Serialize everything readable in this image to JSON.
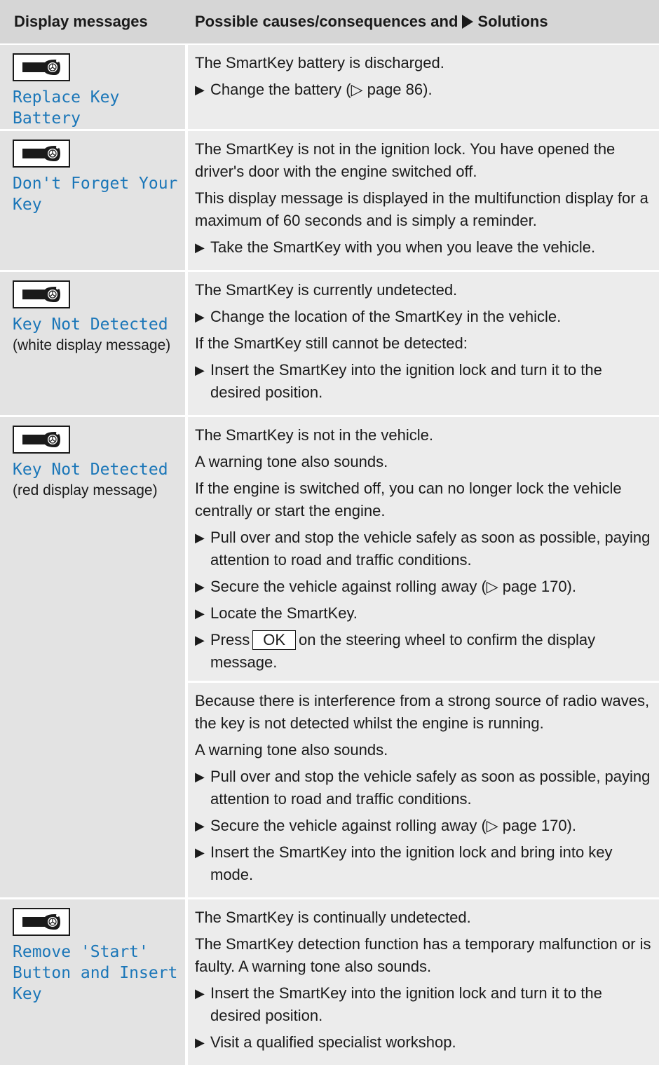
{
  "header": {
    "col1": "Display messages",
    "col2_prefix": "Possible causes/consequences and",
    "col2_suffix": "Solutions"
  },
  "rows": [
    {
      "message": "Replace Key Battery",
      "icon": "smartkey-icon",
      "blocks": [
        {
          "type": "p",
          "text": "The SmartKey battery is discharged."
        },
        {
          "type": "step",
          "text": "Change the battery (▷ page 86)."
        }
      ]
    },
    {
      "message": "Don't Forget Your Key",
      "icon": "smartkey-icon",
      "blocks": [
        {
          "type": "p",
          "text": "The SmartKey is not in the ignition lock. You have opened the driver's door with the engine switched off."
        },
        {
          "type": "p",
          "text": "This display message is displayed in the multifunction display for a maximum of 60 seconds and is simply a reminder."
        },
        {
          "type": "step",
          "text": "Take the SmartKey with you when you leave the vehicle."
        }
      ]
    },
    {
      "message": "Key Not Detected",
      "note": "(white display message)",
      "icon": "smartkey-icon",
      "blocks": [
        {
          "type": "p",
          "text": "The SmartKey is currently undetected."
        },
        {
          "type": "step",
          "text": "Change the location of the SmartKey in the vehicle."
        },
        {
          "type": "p",
          "text": "If the SmartKey still cannot be detected:"
        },
        {
          "type": "step",
          "text": "Insert the SmartKey into the ignition lock and turn it to the desired position."
        }
      ]
    },
    {
      "message": "Key Not Detected",
      "note": "(red display message)",
      "icon": "smartkey-icon",
      "blocks": [
        {
          "type": "p",
          "text": "The SmartKey is not in the vehicle."
        },
        {
          "type": "p",
          "text": "A warning tone also sounds."
        },
        {
          "type": "p",
          "text": "If the engine is switched off, you can no longer lock the vehicle centrally or start the engine."
        },
        {
          "type": "step",
          "text": "Pull over and stop the vehicle safely as soon as possible, paying attention to road and traffic conditions."
        },
        {
          "type": "step",
          "text": "Secure the vehicle against rolling away (▷ page 170)."
        },
        {
          "type": "step",
          "text": "Locate the SmartKey."
        },
        {
          "type": "stepok",
          "before": "Press",
          "key": "OK",
          "after": "on the steering wheel to confirm the display message."
        },
        {
          "type": "divider"
        },
        {
          "type": "p",
          "text": "Because there is interference from a strong source of radio waves, the key is not detected whilst the engine is running."
        },
        {
          "type": "p",
          "text": "A warning tone also sounds."
        },
        {
          "type": "step",
          "text": "Pull over and stop the vehicle safely as soon as possible, paying attention to road and traffic conditions."
        },
        {
          "type": "step",
          "text": "Secure the vehicle against rolling away (▷ page 170)."
        },
        {
          "type": "step",
          "text": "Insert the SmartKey into the ignition lock and bring into key mode."
        }
      ]
    },
    {
      "message": "Remove 'Start' Button and Insert Key",
      "icon": "smartkey-icon",
      "blocks": [
        {
          "type": "p",
          "text": "The SmartKey is continually undetected."
        },
        {
          "type": "p",
          "text": "The SmartKey detection function has a temporary malfunction or is faulty. A warning tone also sounds."
        },
        {
          "type": "step",
          "text": "Insert the SmartKey into the ignition lock and turn it to the desired position."
        },
        {
          "type": "step",
          "text": "Visit a qualified specialist workshop."
        }
      ]
    }
  ]
}
